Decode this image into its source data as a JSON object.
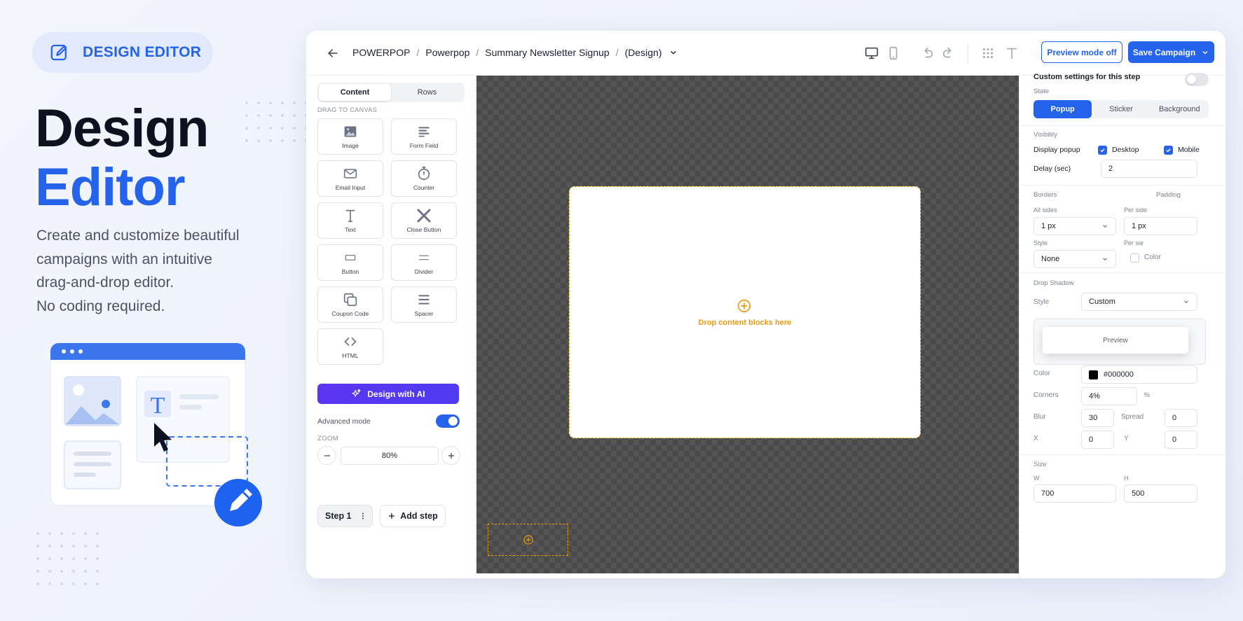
{
  "badge": {
    "label": "DESIGN EDITOR",
    "icon": "edit-square-icon"
  },
  "hero": {
    "title_line1": "Design",
    "title_line2": "Editor",
    "desc_lines": [
      "Create and customize beautiful",
      "campaigns with an intuitive",
      "drag-and-drop editor.",
      "No coding required."
    ]
  },
  "colors": {
    "primary": "#2563eb",
    "ai": "#5b35f0",
    "accent": "#f2a313",
    "canvas": "#4a4a4a"
  },
  "topbar": {
    "breadcrumbs": [
      "POWERPOP",
      "Powerpop",
      "Summary Newsletter Signup",
      "(Design)"
    ],
    "separator": "/",
    "preview_label": "Preview mode off",
    "save_label": "Save Campaign"
  },
  "content_panel": {
    "tabs": [
      "Content",
      "Rows"
    ],
    "drag_label": "DRAG TO CANVAS",
    "blocks": [
      {
        "label": "Image",
        "icon": "image-icon"
      },
      {
        "label": "Form Field",
        "icon": "form-field-icon"
      },
      {
        "label": "Email Input",
        "icon": "email-icon"
      },
      {
        "label": "Counter",
        "icon": "timer-icon"
      },
      {
        "label": "Text",
        "icon": "text-icon"
      },
      {
        "label": "Close Button",
        "icon": "close-icon"
      },
      {
        "label": "Button",
        "icon": "button-icon"
      },
      {
        "label": "Divider",
        "icon": "divider-icon"
      },
      {
        "label": "Coupon Code",
        "icon": "coupon-icon"
      },
      {
        "label": "Spacer",
        "icon": "spacer-icon"
      },
      {
        "label": "HTML",
        "icon": "code-icon"
      }
    ],
    "ai_label": "Design with AI",
    "advanced_label": "Advanced mode",
    "advanced_on": true,
    "zoom_label": "ZOOM",
    "zoom_value": "80%",
    "step_label": "Step 1",
    "add_step_label": "Add step"
  },
  "canvas": {
    "drop_text": "Drop content blocks here"
  },
  "settings": {
    "custom_label": "Custom settings for this step",
    "custom_on": false,
    "state_label": "State",
    "state_tabs": [
      "Popup",
      "Sticker",
      "Background"
    ],
    "visibility_label": "Visibility",
    "display_label": "Display popup",
    "desktop_label": "Desktop",
    "mobile_label": "Mobile",
    "delay_label": "Delay (sec)",
    "delay_value": "2",
    "borders_label": "Borders",
    "padding_label": "Padding",
    "all_sides_label": "All sides",
    "per_side_label": "Per side",
    "border_value": "1 px",
    "padding_value": "1 px",
    "style_label": "Style",
    "per_side_label2": "Per sie",
    "style_value": "None",
    "color_label": "Color",
    "drop_shadow_label": "Drop Shadow",
    "shadow_style_label": "Style",
    "shadow_style_value": "Custom",
    "preview_label": "Preview",
    "shadow_color_label": "Color",
    "shadow_color_value": "#000000",
    "corners_label": "Corners",
    "corners_value": "4%",
    "corners_suffix": "%",
    "blur_label": "Blur",
    "blur_value": "30",
    "spread_label": "Spread",
    "spread_value": "0",
    "x_label": "X",
    "x_value": "0",
    "y_label": "Y",
    "y_value": "0",
    "size_label": "Size",
    "w_label": "W",
    "w_value": "700",
    "h_label": "H",
    "h_value": "500"
  }
}
